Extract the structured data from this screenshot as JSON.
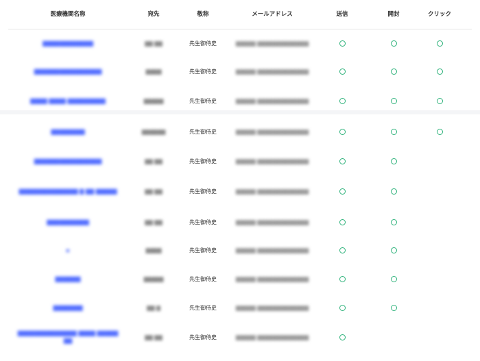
{
  "table": {
    "headers": {
      "institution": "医療機関名称",
      "recipient": "宛先",
      "honorific": "敬称",
      "email": "メールアドレス",
      "sent": "送信",
      "opened": "開封",
      "clicked": "クリック"
    },
    "status_symbol": "○",
    "status_color": "#2db27a",
    "link_color": "#4f6bff",
    "rows": [
      {
        "institution": "▇▇▇▇▇▇▇▇▇▇▇▇",
        "recipient": "▇▇ ▇▇",
        "honorific": "先生御侍史",
        "email": "▇▇▇▇▇ ▇▇▇▇▇▇▇▇▇▇▇▇▇",
        "sent": true,
        "opened": true,
        "clicked": true
      },
      {
        "institution": "▇▇▇▇▇▇▇▇▇▇▇▇▇▇▇▇",
        "recipient": "▇▇▇▇",
        "honorific": "先生御侍史",
        "email": "▇▇▇▇▇ ▇▇▇▇▇▇▇▇▇▇▇▇▇",
        "sent": true,
        "opened": true,
        "clicked": true
      },
      {
        "institution": "▇▇▇▇ ▇▇▇▇ ▇▇▇▇▇▇▇▇▇",
        "recipient": "▇▇▇▇▇",
        "honorific": "先生御侍史",
        "email": "▇▇▇▇▇ ▇▇▇▇▇▇▇▇▇▇▇▇▇",
        "sent": true,
        "opened": true,
        "clicked": true
      },
      {
        "institution": "▇▇▇▇▇▇▇▇",
        "recipient": "▇▇▇▇▇▇",
        "honorific": "先生御侍史",
        "email": "▇▇▇▇▇ ▇▇▇▇▇▇▇▇▇▇▇▇▇",
        "sent": true,
        "opened": true,
        "clicked": true
      },
      {
        "institution": "▇▇▇▇▇▇▇▇▇▇▇▇▇▇▇▇",
        "recipient": "▇▇ ▇▇",
        "honorific": "先生御侍史",
        "email": "▇▇▇▇▇ ▇▇▇▇▇▇▇▇▇▇▇▇▇",
        "sent": true,
        "opened": true,
        "clicked": false
      },
      {
        "institution": "▇▇▇▇▇▇▇▇▇▇▇▇▇▇ ▇ ▇▇ ▇▇▇▇▇",
        "recipient": "▇▇ ▇▇",
        "honorific": "先生御侍史",
        "email": "▇▇▇▇▇ ▇▇▇▇▇▇▇▇▇▇▇▇▇",
        "sent": true,
        "opened": true,
        "clicked": false
      },
      {
        "institution": "▇▇▇▇▇▇▇▇▇▇",
        "recipient": "▇▇ ▇▇",
        "honorific": "先生御侍史",
        "email": "▇▇▇▇▇ ▇▇▇▇▇▇▇▇▇▇▇▇▇",
        "sent": true,
        "opened": true,
        "clicked": false
      },
      {
        "institution": "▪",
        "recipient": "▇▇▇▇",
        "honorific": "先生御侍史",
        "email": "▇▇▇▇▇ ▇▇▇▇▇▇▇▇▇▇▇▇▇",
        "sent": true,
        "opened": true,
        "clicked": false
      },
      {
        "institution": "▇▇▇▇▇▇",
        "recipient": "▇▇▇▇▇",
        "honorific": "先生御侍史",
        "email": "▇▇▇▇▇ ▇▇▇▇▇▇▇▇▇▇▇▇▇",
        "sent": true,
        "opened": true,
        "clicked": false
      },
      {
        "institution": "▇▇▇▇▇▇▇",
        "recipient": "▇▇ ▇",
        "honorific": "先生御侍史",
        "email": "▇▇▇▇▇ ▇▇▇▇▇▇▇▇▇▇▇▇▇",
        "sent": true,
        "opened": true,
        "clicked": false
      },
      {
        "institution": "▇▇▇▇▇▇▇▇▇▇▇▇▇▇ ▇▇▇▇ ▇▇▇▇▇▇▇",
        "recipient": "▇▇ ▇▇",
        "honorific": "先生御侍史",
        "email": "▇▇▇▇▇ ▇▇▇▇▇▇▇▇▇▇▇▇▇",
        "sent": true,
        "opened": false,
        "clicked": false
      }
    ]
  }
}
